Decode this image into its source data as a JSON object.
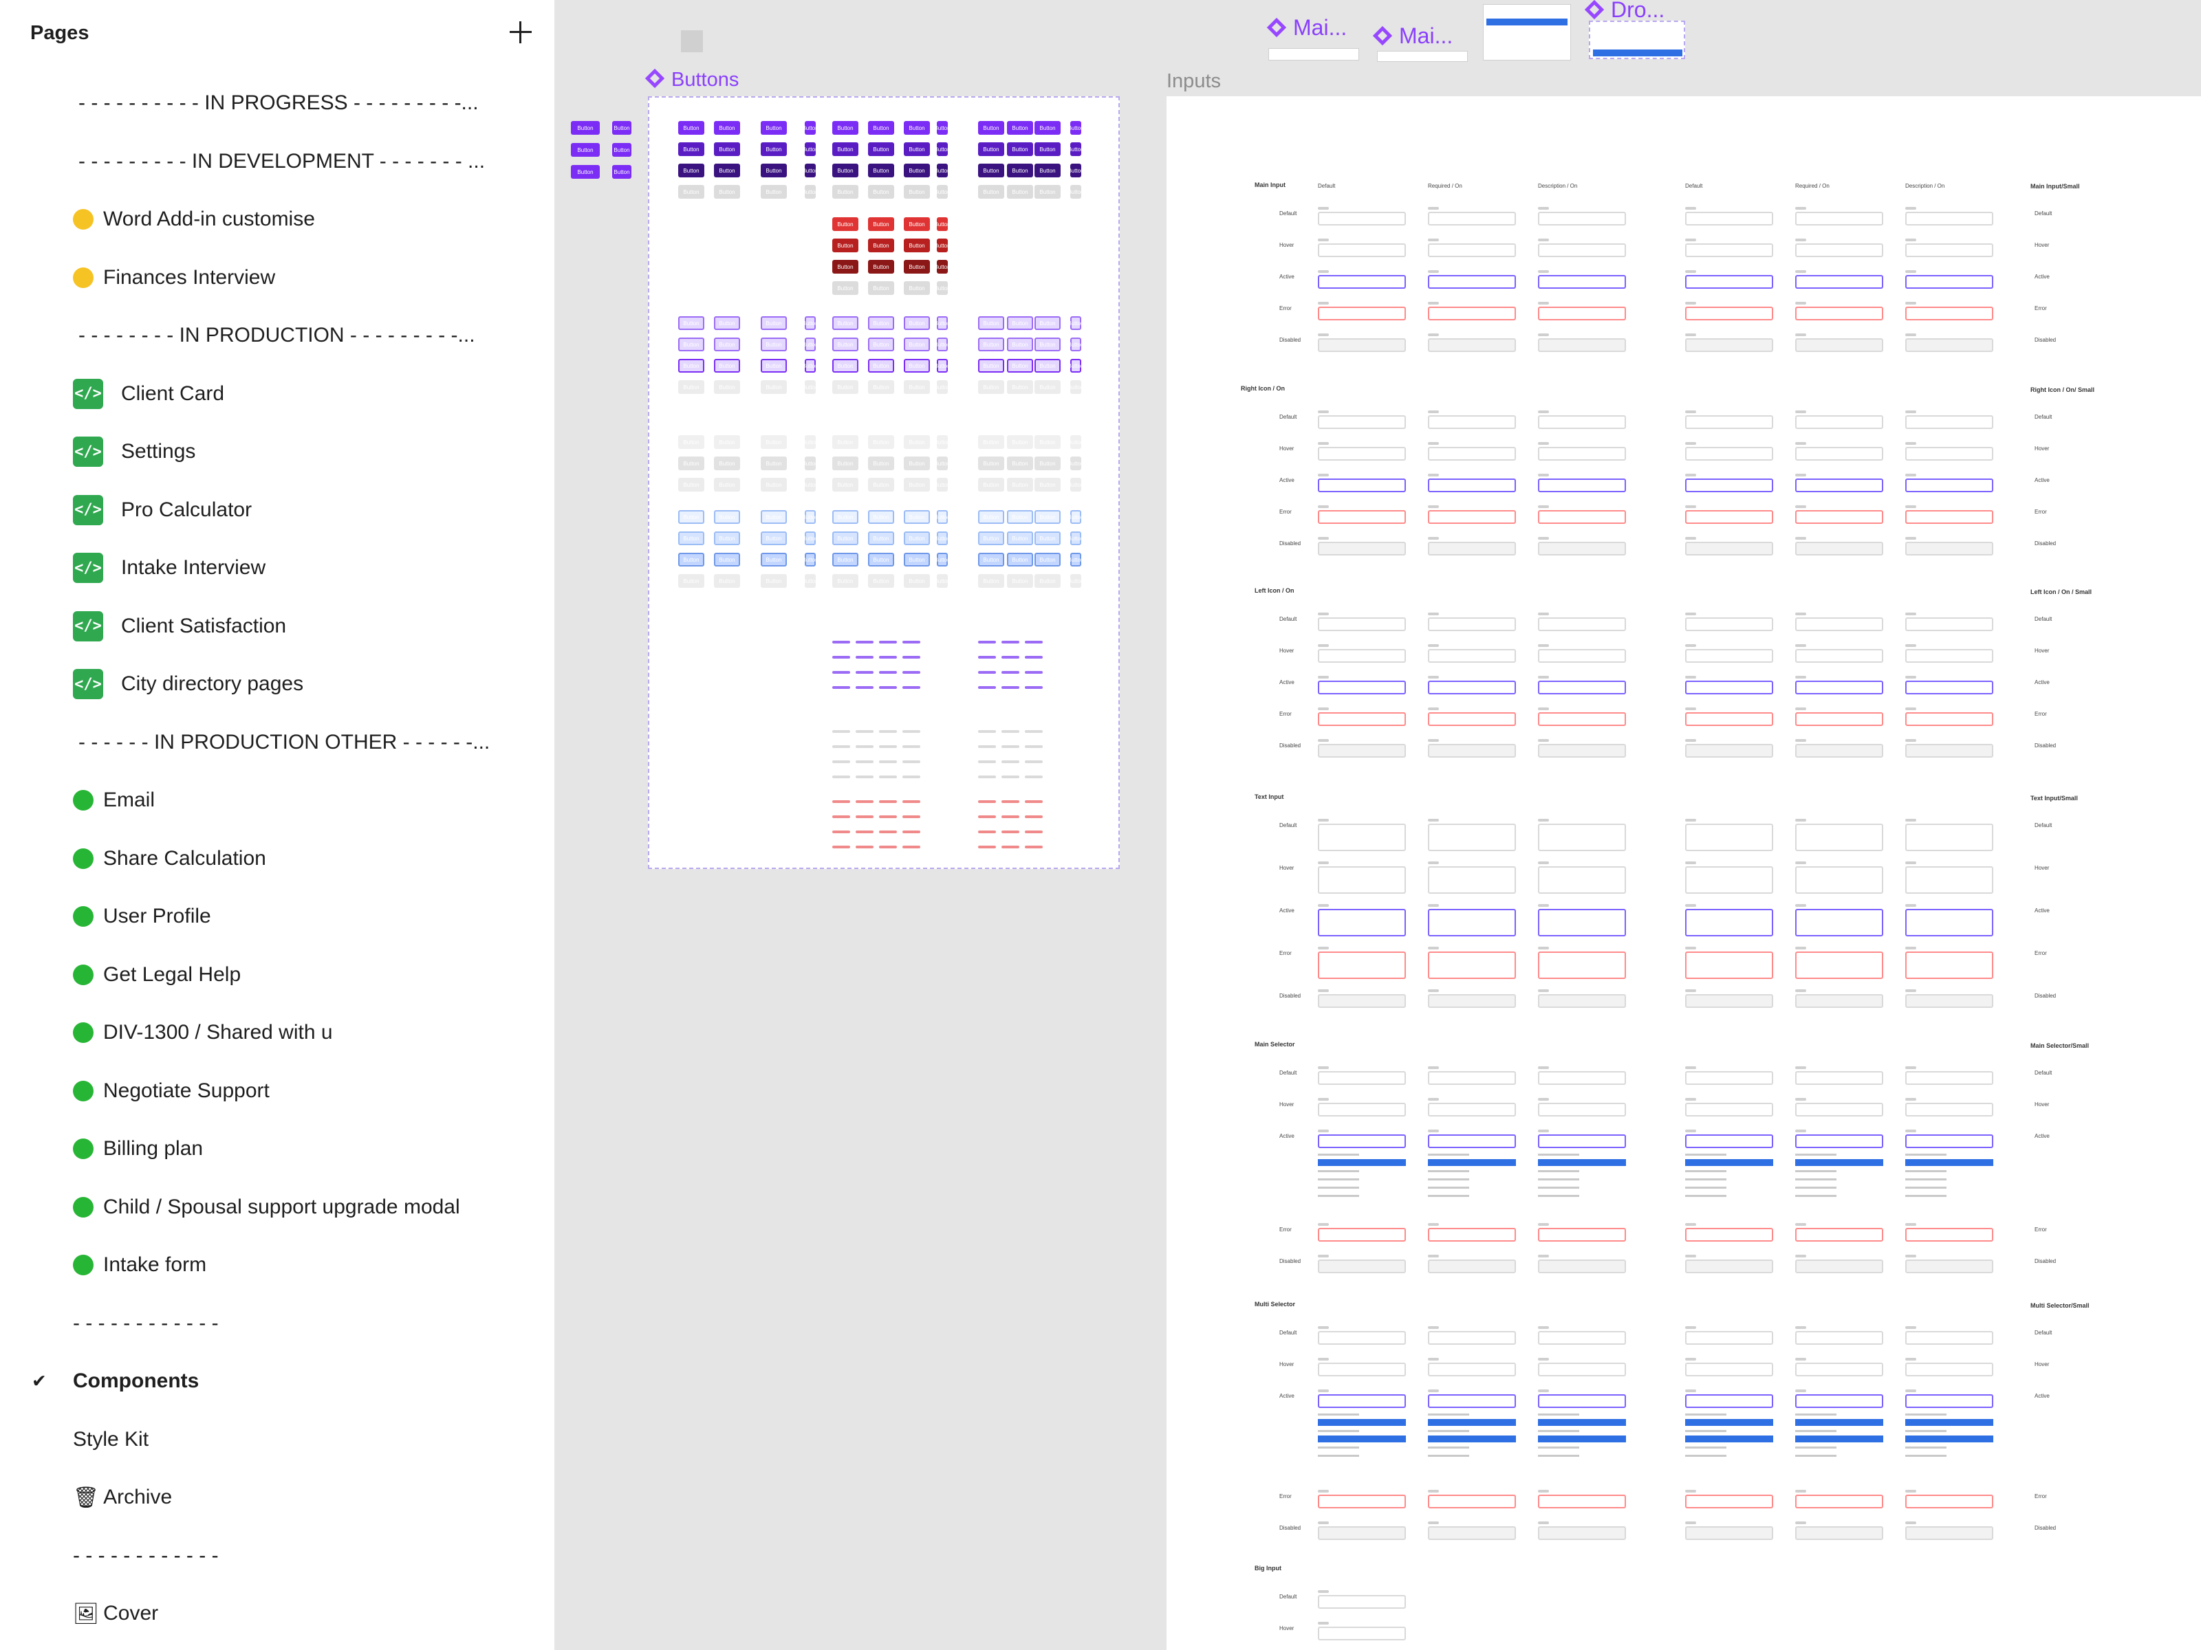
{
  "sidebar": {
    "title": "Pages",
    "pages": [
      {
        "label": "- - - - - - - - - - IN PROGRESS - - - - - - - - -...",
        "type": "separator"
      },
      {
        "label": "- - - - - - - - - IN DEVELOPMENT - - - - - - - ...",
        "type": "separator"
      },
      {
        "label": "Word Add-in customise",
        "type": "page",
        "marker": "yellow-dot"
      },
      {
        "label": " Finances Interview",
        "type": "page",
        "marker": "yellow-dot"
      },
      {
        "label": "- - - - -  - -  - IN PRODUCTION - - - - - - - - -...",
        "type": "separator"
      },
      {
        "label": " Client Card",
        "type": "page",
        "marker": "code"
      },
      {
        "label": "Settings",
        "type": "page",
        "marker": "code"
      },
      {
        "label": " Pro Calculator",
        "type": "page",
        "marker": "code"
      },
      {
        "label": "Intake Interview",
        "type": "page",
        "marker": "code"
      },
      {
        "label": "Client Satisfaction",
        "type": "page",
        "marker": "code"
      },
      {
        "label": "City directory pages",
        "type": "page",
        "marker": "code"
      },
      {
        "label": "- - - - - - IN PRODUCTION OTHER  - - - - - -...",
        "type": "separator"
      },
      {
        "label": " Email",
        "type": "page",
        "marker": "green-dot"
      },
      {
        "label": " Share Calculation",
        "type": "page",
        "marker": "green-dot"
      },
      {
        "label": " User Profile",
        "type": "page",
        "marker": "green-dot"
      },
      {
        "label": " Get Legal Help",
        "type": "page",
        "marker": "green-dot"
      },
      {
        "label": " DIV-1300 / Shared with u",
        "type": "page",
        "marker": "green-dot"
      },
      {
        "label": "Negotiate Support",
        "type": "page",
        "marker": "green-dot"
      },
      {
        "label": "Billing plan",
        "type": "page",
        "marker": "green-dot"
      },
      {
        "label": "Child / Spousal support upgrade modal",
        "type": "page",
        "marker": "green-dot"
      },
      {
        "label": "Intake form",
        "type": "page",
        "marker": "green-dot"
      },
      {
        "label": "- - - - - - - - - - - -",
        "type": "separator-plain"
      },
      {
        "label": "Components",
        "type": "page",
        "marker": "none",
        "active": true
      },
      {
        "label": "Style Kit",
        "type": "page",
        "marker": "none"
      },
      {
        "label": "Archive",
        "type": "page",
        "marker": "trash-emoji"
      },
      {
        "label": "- - - - - - - - - - - -",
        "type": "separator-plain"
      },
      {
        "label": "Cover",
        "type": "page",
        "marker": "picture-emoji"
      }
    ]
  },
  "canvas": {
    "buttons_frame_title": "Buttons",
    "inputs_frame_title": "Inputs",
    "floating_titles": [
      "Mai...",
      "Mai...",
      "Dro..."
    ],
    "mini_button_label": "Button",
    "inputs_column_headers": [
      "Default",
      "Required / On",
      "Description / On",
      "Default",
      "Required / On",
      "Description / On"
    ],
    "inputs_sections": [
      {
        "title": "Main Input",
        "small_title": "Main Input/Small"
      },
      {
        "title": "Right Icon / On",
        "small_title": "Right Icon / On/ Small"
      },
      {
        "title": "Left Icon / On",
        "small_title": "Left Icon / On / Small"
      },
      {
        "title": "Text Input",
        "small_title": "Text Input/Small"
      },
      {
        "title": "Main Selector",
        "small_title": "Main Selector/Small"
      },
      {
        "title": "Multi Selector",
        "small_title": "Multi Selector/Small"
      },
      {
        "title": "Big Input",
        "small_title": ""
      }
    ],
    "state_labels": [
      "Default",
      "Hover",
      "Active",
      "Error",
      "Disabled"
    ],
    "placeholder": "Placeholder text"
  },
  "colors": {
    "accent": "#8a3ffc",
    "code_badge": "#2fa84f",
    "green_dot": "#27b535",
    "yellow_dot": "#f6c324",
    "button_purple": "#7b2cf5",
    "button_dark": "#3a1380",
    "button_red": "#e03434",
    "select_blue": "#2f6fe4"
  }
}
